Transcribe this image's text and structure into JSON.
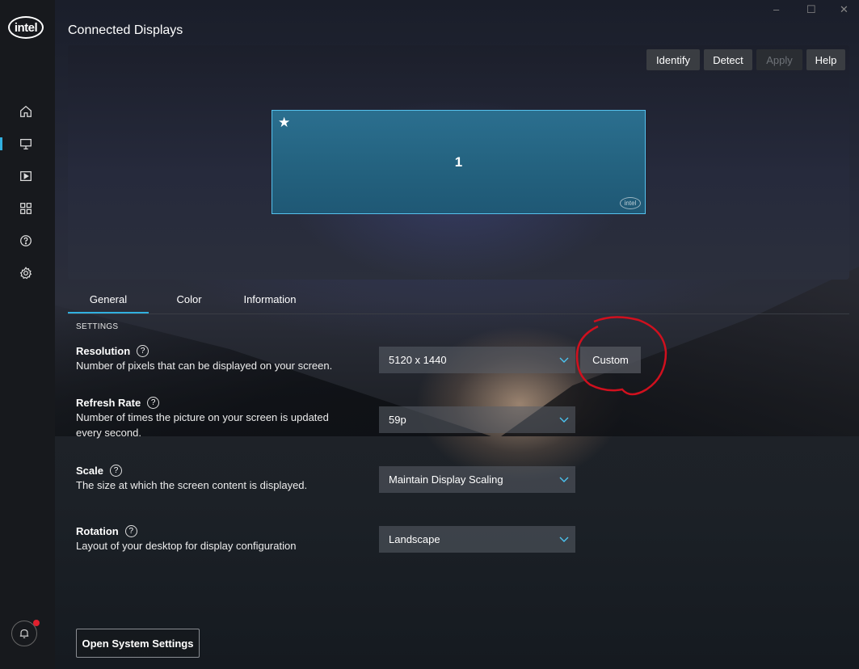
{
  "brand": {
    "logo_text": "intel"
  },
  "header": {
    "title": "Connected Displays"
  },
  "window_controls": {
    "minimize": "–",
    "maximize": "☐",
    "close": "✕"
  },
  "sidebar": {
    "items": [
      {
        "name": "home",
        "icon": "home-icon"
      },
      {
        "name": "display",
        "icon": "monitor-icon",
        "active": true
      },
      {
        "name": "video",
        "icon": "video-icon"
      },
      {
        "name": "apps",
        "icon": "grid-icon"
      },
      {
        "name": "help",
        "icon": "question-icon"
      },
      {
        "name": "settings",
        "icon": "gear-icon"
      }
    ],
    "notification": {
      "icon": "bell-icon",
      "has_alert": true
    }
  },
  "toolbar": {
    "identify": "Identify",
    "detect": "Detect",
    "apply": "Apply",
    "help": "Help"
  },
  "preview": {
    "display_number": "1",
    "primary_star": "★",
    "monitor_logo": "intel"
  },
  "tabs": [
    {
      "label": "General",
      "active": true
    },
    {
      "label": "Color",
      "active": false
    },
    {
      "label": "Information",
      "active": false
    }
  ],
  "settings": {
    "section_label": "SETTINGS",
    "help_glyph": "?",
    "resolution": {
      "title": "Resolution",
      "desc": "Number of pixels that can be displayed on your screen.",
      "value": "5120 x 1440",
      "custom_label": "Custom"
    },
    "refresh_rate": {
      "title": "Refresh Rate",
      "desc_line1": "Number of times the picture on your screen is updated",
      "desc_line2": "every second.",
      "value": "59p"
    },
    "scale": {
      "title": "Scale",
      "desc": "The size at which the screen content is displayed.",
      "value": "Maintain Display Scaling"
    },
    "rotation": {
      "title": "Rotation",
      "desc": "Layout of your desktop for display configuration",
      "value": "Landscape"
    }
  },
  "footer": {
    "open_system_settings": "Open System Settings"
  },
  "colors": {
    "accent": "#31b0e0",
    "alert": "#e0202e",
    "annotation": "#d0101e",
    "monitor_fill": "#2b6f8f"
  }
}
